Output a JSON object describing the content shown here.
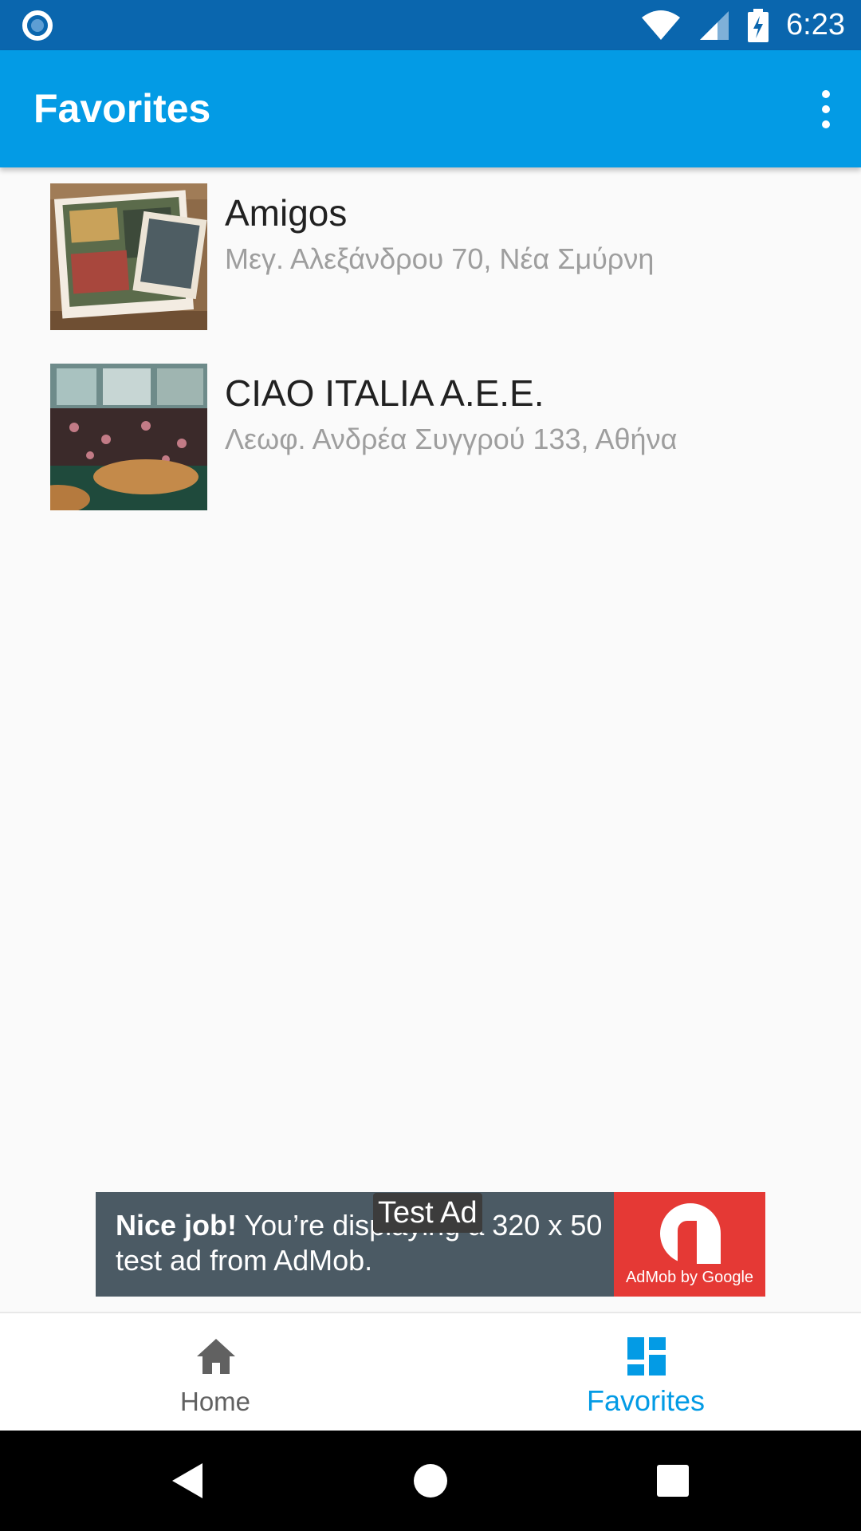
{
  "status_bar": {
    "time": "6:23",
    "left_icon": "notification-circle-icon",
    "wifi_icon": "wifi-icon",
    "signal_icon": "cell-signal-icon",
    "battery_icon": "battery-charging-icon"
  },
  "app_bar": {
    "title": "Favorites",
    "menu_icon": "overflow-menu-icon"
  },
  "favorites": [
    {
      "name": "Amigos",
      "address": "Μεγ. Αλεξάνδρου 70, Νέα Σμύρνη"
    },
    {
      "name": "CIAO ITALIA A.E.E.",
      "address": "Λεωφ. Ανδρέα Συγγρού 133, Αθήνα"
    }
  ],
  "ad": {
    "badge": "Test Ad",
    "headline_bold": "Nice job!",
    "headline_rest": " You’re displaying a 320 x 50 test ad from AdMob.",
    "logo_label": "AdMob by Google"
  },
  "bottom_nav": {
    "home_label": "Home",
    "favorites_label": "Favorites",
    "active_color": "#039be5",
    "inactive_color": "#616161"
  },
  "colors": {
    "status_bar": "#0a66ae",
    "app_bar": "#039be5",
    "ad_background": "#4b5a64",
    "ad_logo": "#e53935"
  }
}
